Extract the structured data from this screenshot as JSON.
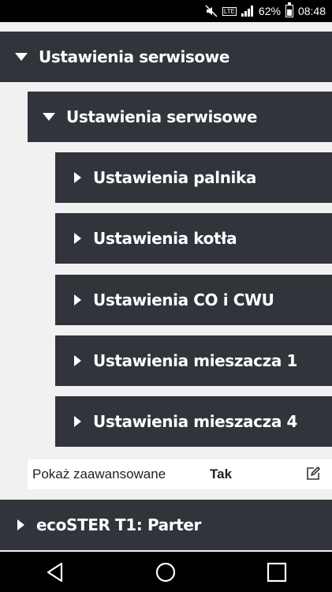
{
  "status_bar": {
    "battery_percent": "62%",
    "time": "08:48",
    "network_label": "LTE",
    "icons": [
      "mute-icon",
      "lte-icon",
      "signal-icon",
      "battery-icon"
    ]
  },
  "tree": {
    "root": {
      "label": "Ustawienia serwisowe",
      "expanded": true
    },
    "child": {
      "label": "Ustawienia serwisowe",
      "expanded": true
    },
    "leaves": [
      {
        "label": "Ustawienia palnika"
      },
      {
        "label": "Ustawienia kotła"
      },
      {
        "label": "Ustawienia CO i CWU"
      },
      {
        "label": "Ustawienia mieszacza 1"
      },
      {
        "label": "Ustawienia mieszacza 4"
      }
    ],
    "advanced": {
      "label": "Pokaż zaawansowane",
      "value": "Tak"
    },
    "next_root": {
      "label": "ecoSTER T1: Parter",
      "expanded": false
    }
  },
  "colors": {
    "row_bg": "#32343c",
    "page_bg": "#f1f1f1"
  }
}
